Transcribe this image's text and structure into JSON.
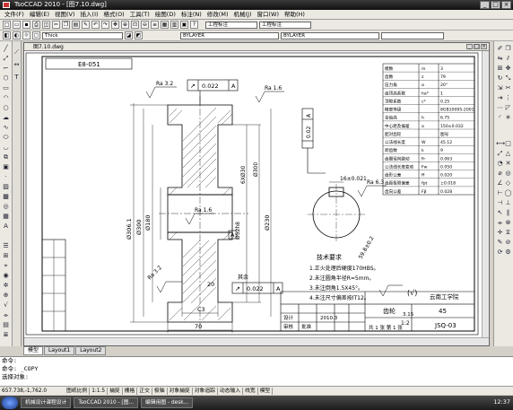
{
  "app": {
    "title": "TsoCCAD 2010 - [图7.10.dwg]",
    "window_buttons": [
      "_",
      "□",
      "×"
    ]
  },
  "menu": [
    "文件(F)",
    "编辑(E)",
    "视图(V)",
    "插入(I)",
    "格式(O)",
    "工具(T)",
    "绘图(D)",
    "标注(N)",
    "修改(M)",
    "机械(J)",
    "窗口(W)",
    "帮助(H)"
  ],
  "toolbar": {
    "layer_combo": "Thick",
    "linetype_combo": "BYLAYER",
    "lineweight_combo": "BYLAYER",
    "style_combo": "工程标注",
    "dim_combo": "工程标注"
  },
  "document": {
    "title": "图7.10.dwg",
    "doc_buttons": [
      "_",
      "□",
      "×"
    ]
  },
  "drawing": {
    "stamp_code": "E8-051",
    "dims": {
      "d_outer": "Ø306.1",
      "d_bore_outer": "Ø300",
      "d_hub": "Ø180",
      "d_230": "Ø230",
      "d_pitch": "Ø52h8",
      "d_4x": "6XØ30",
      "d_gear": "Ø300",
      "hub_width": "70",
      "width_20": "20",
      "width_c3": "C3",
      "key_width": "16±0.021",
      "key_depth": "59.8±0.2",
      "left_size": "82",
      "left_size_2": "Φ8"
    },
    "roughness": {
      "r1": "Ra 3.2",
      "r2": "Ra 1.6",
      "r3": "Ra 1.6",
      "r4": "Ra 3.2",
      "r5": "Ra 3.2",
      "r6": "Ra 6.3",
      "r_other": "其余"
    },
    "tolerance_frames": [
      {
        "sym": "↗",
        "val": "0.022",
        "ref": "A"
      },
      {
        "sym": "↗",
        "val": "0.022",
        "ref": "A"
      },
      {
        "sym": "⌯",
        "val": "0.02",
        "ref": "A"
      }
    ],
    "datum_label": "A",
    "notes_title": "技术要求",
    "notes": [
      "1.正火处理后硬度170HBS。",
      "2.未注圆角半径R=5mm。",
      "3.未注倒角1.5X45°。",
      "4.未注尺寸偏差按IT12。"
    ],
    "title_block": {
      "part_name": "齿轮",
      "school": "云南工学院",
      "material": "45",
      "drawing_no": "JSQ-03",
      "scale": "1:2",
      "sheet": "共 1 张  第 1 张",
      "weight": "3.15",
      "date": "2010.3",
      "design": "设计",
      "check": "审核",
      "approve": "批准"
    },
    "params_table": {
      "rows": [
        [
          "模数",
          "m",
          "3"
        ],
        [
          "齿数",
          "z",
          "79"
        ],
        [
          "压力角",
          "α",
          "20°"
        ],
        [
          "齿顶高系数",
          "ha*",
          "1"
        ],
        [
          "顶隙系数",
          "c*",
          "0.25"
        ],
        [
          "精度等级",
          "",
          "8GB10095-2001"
        ],
        [
          "全齿高",
          "h",
          "6.75"
        ],
        [
          "中心距及偏差",
          "a",
          "150±0.032"
        ],
        [
          "配对齿轮",
          "",
          "图号"
        ],
        [
          "公法线长度",
          "W",
          "45.12"
        ],
        [
          "跨齿数",
          "k",
          "9"
        ],
        [
          "齿圈径向跳动",
          "Fr",
          "0.063"
        ],
        [
          "公法线长度变动",
          "Fw",
          "0.050"
        ],
        [
          "齿形公差",
          "ff",
          "0.020"
        ],
        [
          "齿距极限偏差",
          "fpt",
          "±0.018"
        ],
        [
          "齿向公差",
          "Fβ",
          "0.028"
        ]
      ]
    }
  },
  "layout_tabs": [
    "模型",
    "Layout1",
    "Layout2"
  ],
  "command": {
    "line1": "命令:",
    "line2": "命令: _COPY",
    "line3": "选择对象:"
  },
  "status": {
    "coords": "657.738,-1,762.0",
    "buttons": [
      "图纸比例",
      "1:1.5",
      "捕捉",
      "栅格",
      "正交",
      "极轴",
      "对象捕捉",
      "对象追踪",
      "动态输入",
      "线宽",
      "模型"
    ]
  },
  "taskbar": {
    "tasks": [
      "机械设计课程设计",
      "TsoCCAD 2010 - [图...",
      "编辑用图 - desk..."
    ],
    "clock": "12:37"
  }
}
